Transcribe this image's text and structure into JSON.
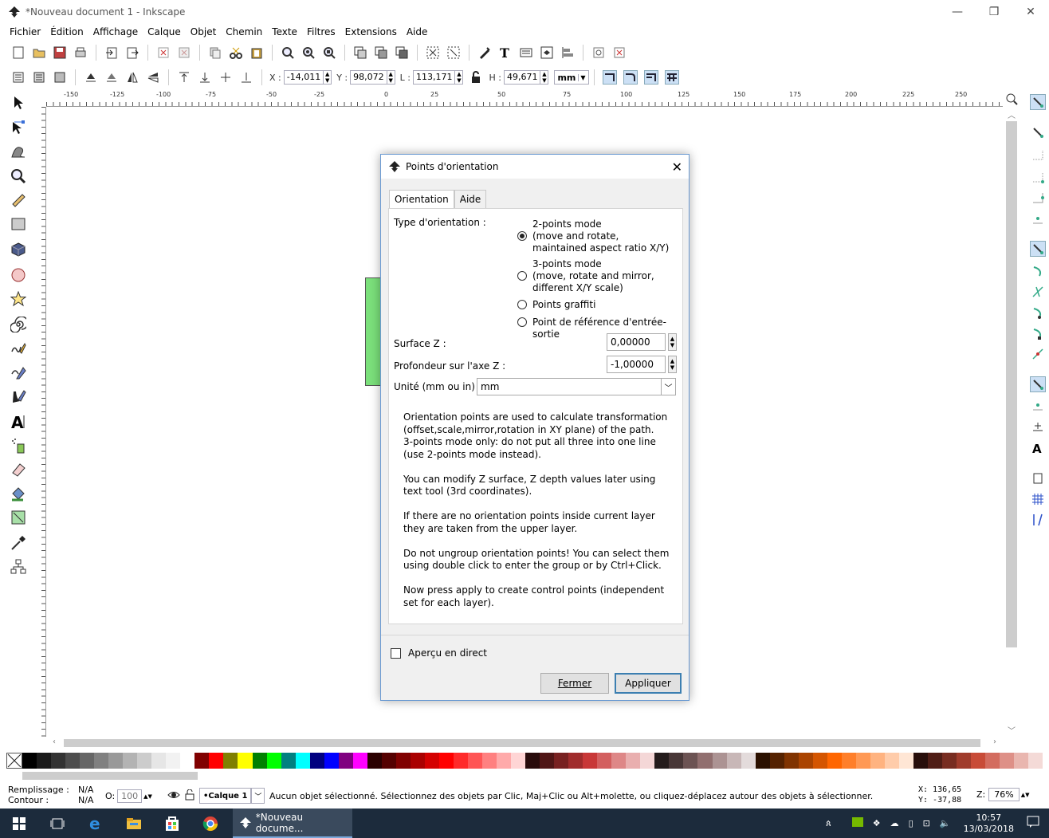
{
  "window": {
    "title": "*Nouveau document 1 - Inkscape",
    "controls": [
      "—",
      "❐",
      "✕"
    ]
  },
  "menu": [
    "Fichier",
    "Édition",
    "Affichage",
    "Calque",
    "Objet",
    "Chemin",
    "Texte",
    "Filtres",
    "Extensions",
    "Aide"
  ],
  "toolbar2": {
    "x_label": "X :",
    "x_value": "-14,011",
    "y_label": "Y :",
    "y_value": "98,072",
    "w_label": "L :",
    "w_value": "113,171",
    "h_label": "H :",
    "h_value": "49,671",
    "unit": "mm"
  },
  "ruler": {
    "h_labels": [
      "-150",
      "-125",
      "-100",
      "-75",
      "-50",
      "-25",
      "0",
      "25",
      "50",
      "75",
      "100",
      "125",
      "150",
      "175",
      "200",
      "225",
      "250"
    ]
  },
  "dialog": {
    "title": "Points d'orientation",
    "tabs": [
      "Orientation",
      "Aide"
    ],
    "type_label": "Type d'orientation :",
    "options": [
      "2-points mode\n(move and rotate,\nmaintained aspect ratio X/Y)",
      "3-points mode\n(move, rotate and mirror,\ndifferent X/Y scale)",
      "Points graffiti",
      "Point de référence d'entrée-sortie"
    ],
    "surface_label": "Surface Z :",
    "surface_value": "0,00000",
    "depth_label": "Profondeur sur l'axe Z :",
    "depth_value": "-1,00000",
    "unit_label": "Unité (mm ou in) :",
    "unit_value": "mm",
    "help": [
      "Orientation points are used to calculate transformation (offset,scale,mirror,rotation in XY plane) of the path.\n3-points mode only: do not put all three into one line (use 2-points mode instead).",
      "You can modify Z surface, Z depth values later using text tool (3rd coordinates).",
      "If there are no orientation points inside current layer they are taken from the upper layer.",
      "Do not ungroup orientation points! You can select them using double click to enter the group or by Ctrl+Click.",
      "Now press apply to create control points (independent set for each layer)."
    ],
    "preview_label": "Aperçu en direct",
    "close_button": "Fermer",
    "apply_button": "Appliquer"
  },
  "status": {
    "fill_label": "Remplissage :",
    "stroke_label": "Contour :",
    "fill_value": "N/A",
    "stroke_value": "N/A",
    "opacity_label": "O:",
    "opacity_value": "100",
    "layer": "•Calque 1",
    "message": "Aucun objet sélectionné. Sélectionnez des objets par Clic, Maj+Clic ou Alt+molette, ou cliquez-déplacez autour des objets à sélectionner.",
    "cursor_x": "X:  136,65",
    "cursor_y": "Y:  -37,88",
    "zoom_label": "Z:",
    "zoom_value": "76%"
  },
  "taskbar": {
    "app_label": "*Nouveau docume...",
    "time": "10:57",
    "date": "13/03/2018"
  },
  "palette": [
    "#000000",
    "#1a1a1a",
    "#333333",
    "#4d4d4d",
    "#666666",
    "#808080",
    "#999999",
    "#b3b3b3",
    "#cccccc",
    "#e6e6e6",
    "#f2f2f2",
    "#ffffff",
    "#800000",
    "#ff0000",
    "#808000",
    "#ffff00",
    "#008000",
    "#00ff00",
    "#008080",
    "#00ffff",
    "#000080",
    "#0000ff",
    "#800080",
    "#ff00ff",
    "#2b0000",
    "#550000",
    "#800000",
    "#aa0000",
    "#d40000",
    "#ff0000",
    "#ff2a2a",
    "#ff5555",
    "#ff8080",
    "#ffaaaa",
    "#ffd5d5",
    "#280b0b",
    "#501616",
    "#782121",
    "#a02c2c",
    "#c83737",
    "#d35f5f",
    "#de8787",
    "#e9afaf",
    "#f4d7d7",
    "#241c1c",
    "#483737",
    "#6c5353",
    "#916f6f",
    "#ac9393",
    "#c8b7b7",
    "#e3dbdb",
    "#2b1100",
    "#552200",
    "#803300",
    "#aa4400",
    "#d45500",
    "#ff6600",
    "#ff7f2a",
    "#ff9955",
    "#ffb380",
    "#ffccaa",
    "#ffe6d5",
    "#280f0b",
    "#501e16",
    "#782d21",
    "#a03c2c",
    "#c84b37",
    "#d36c5f",
    "#de9087",
    "#e9b6af",
    "#f4dad7"
  ]
}
